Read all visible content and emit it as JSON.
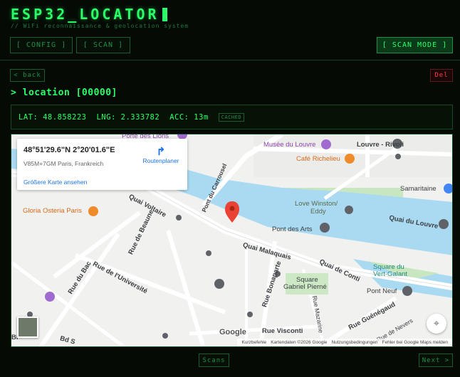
{
  "app": {
    "title": "ESP32_LOCATOR",
    "subtitle": "// WiFi reconnaissance & geolocation system"
  },
  "nav": {
    "config_label": "[ CONFIG ]",
    "scan_label": "[ SCAN ]",
    "mode_label": "[ SCAN MODE ]"
  },
  "actions": {
    "back_label": "< back",
    "del_label": "Del"
  },
  "location": {
    "heading": "> location [00000]",
    "lat": "LAT: 48.858223",
    "lng": "LNG: 2.333782",
    "acc": "ACC: 13m",
    "badge": "CACHED"
  },
  "map": {
    "infocard": {
      "coords": "48°51'29.6\"N 2°20'01.6\"E",
      "plus_code": "V85M+7GM Paris, Frankreich",
      "link": "Größere Karte ansehen",
      "route_label": "Routenplaner"
    },
    "labels": {
      "l1": "Porte des Lions",
      "l2": "Musée du Louvre",
      "l3": "Louvre - Rivoli",
      "l4": "Café Richelieu",
      "l5": "Samaritaine",
      "l6": "Gloria Osteria Paris",
      "l7": "Quai Voltaire",
      "l8": "Pont du Carrousel",
      "l9": "Love Winston/",
      "l10": "Eddy",
      "l11": "Pont des Arts",
      "l12": "Quai du Louvre",
      "l13": "Rue de Beaune",
      "l14": "Quai Malaquais",
      "l15": "Rue du Bac",
      "l16": "Rue de l'Université",
      "l17": "Rue Bonaparte",
      "l18": "Quai de Conti",
      "l19": "Square du",
      "l20": "Vert-Galant",
      "l21": "Square",
      "l22": "Gabriel Pierné",
      "l23": "Pont Neuf",
      "l24": "Rue Mazarine",
      "l25": "Rue Guénégaud",
      "l26": "Rue de Nevers",
      "l27": "Rue Visconti",
      "l28": "Bd S",
      "l29": "Bi"
    },
    "google_logo": "Google",
    "attribution": {
      "shortcuts": "Kurzbefehle",
      "data": "Kartendaten ©2026 Google",
      "terms": "Nutzungsbedingungen",
      "report": "Fehler bei Google Maps melden"
    }
  },
  "footer": {
    "scans_label": "Scans",
    "next_label": "Next >"
  }
}
